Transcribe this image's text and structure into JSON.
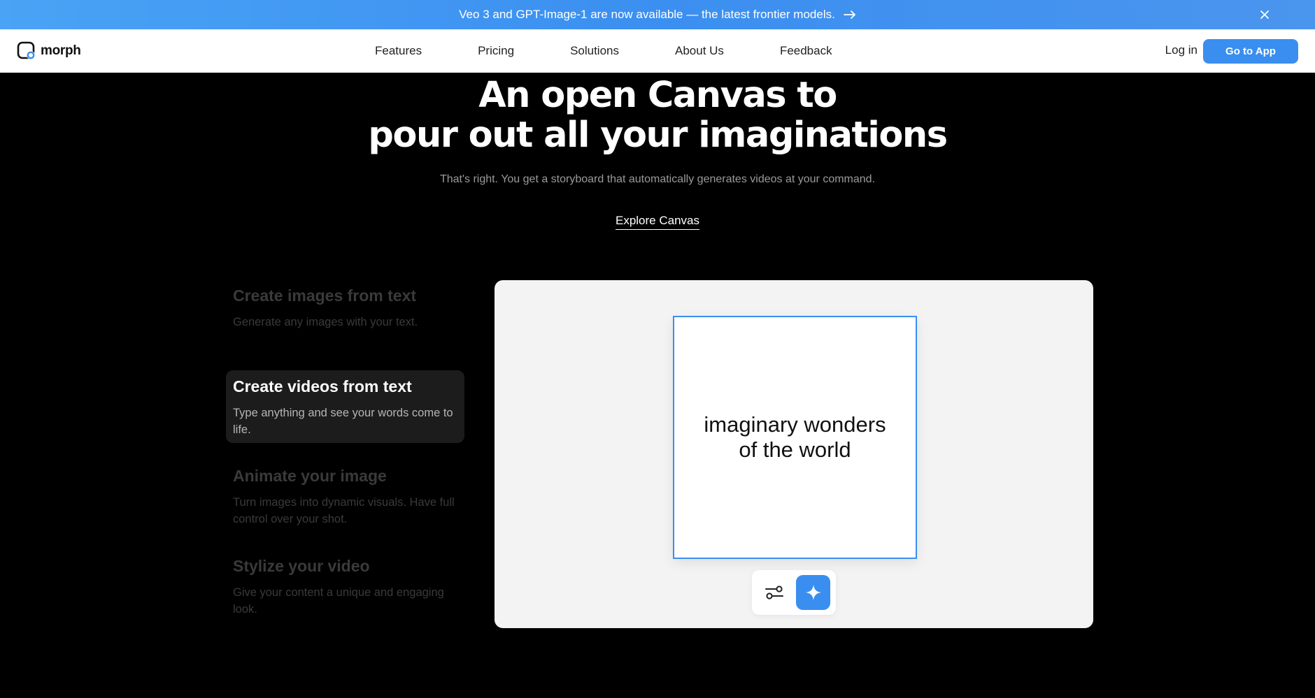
{
  "banner": {
    "text": "Veo 3 and GPT-Image-1 are now available — the latest frontier models.",
    "arrow_icon": "arrow-right-icon",
    "close_icon": "close-icon"
  },
  "nav": {
    "logo_text": "morph",
    "links": [
      "Features",
      "Pricing",
      "Solutions",
      "About Us",
      "Feedback"
    ],
    "login": "Log in",
    "cta": "Go to App"
  },
  "hero": {
    "title_line1": "An open Canvas to",
    "title_line2": "pour out all your imaginations",
    "subtitle": "That's right. You get a storyboard that automatically generates videos at your command.",
    "link": "Explore Canvas"
  },
  "features": [
    {
      "title": "Create images from text",
      "desc": "Generate any images with your text.",
      "active": false
    },
    {
      "title": "Create videos from text",
      "desc": "Type anything and see your words come to life.",
      "active": true
    },
    {
      "title": "Animate your image",
      "desc": "Turn images into dynamic visuals. Have full control over your shot.",
      "active": false
    },
    {
      "title": "Stylize your video",
      "desc": "Give your content a unique and engaging look.",
      "active": false
    }
  ],
  "canvas": {
    "card_text_line1": "imaginary wonders",
    "card_text_line2": "of the world",
    "settings_icon": "sliders-icon",
    "generate_icon": "sparkle-icon"
  },
  "colors": {
    "accent": "#3a8ef0",
    "banner": "#4a9af2",
    "background": "#000000"
  }
}
